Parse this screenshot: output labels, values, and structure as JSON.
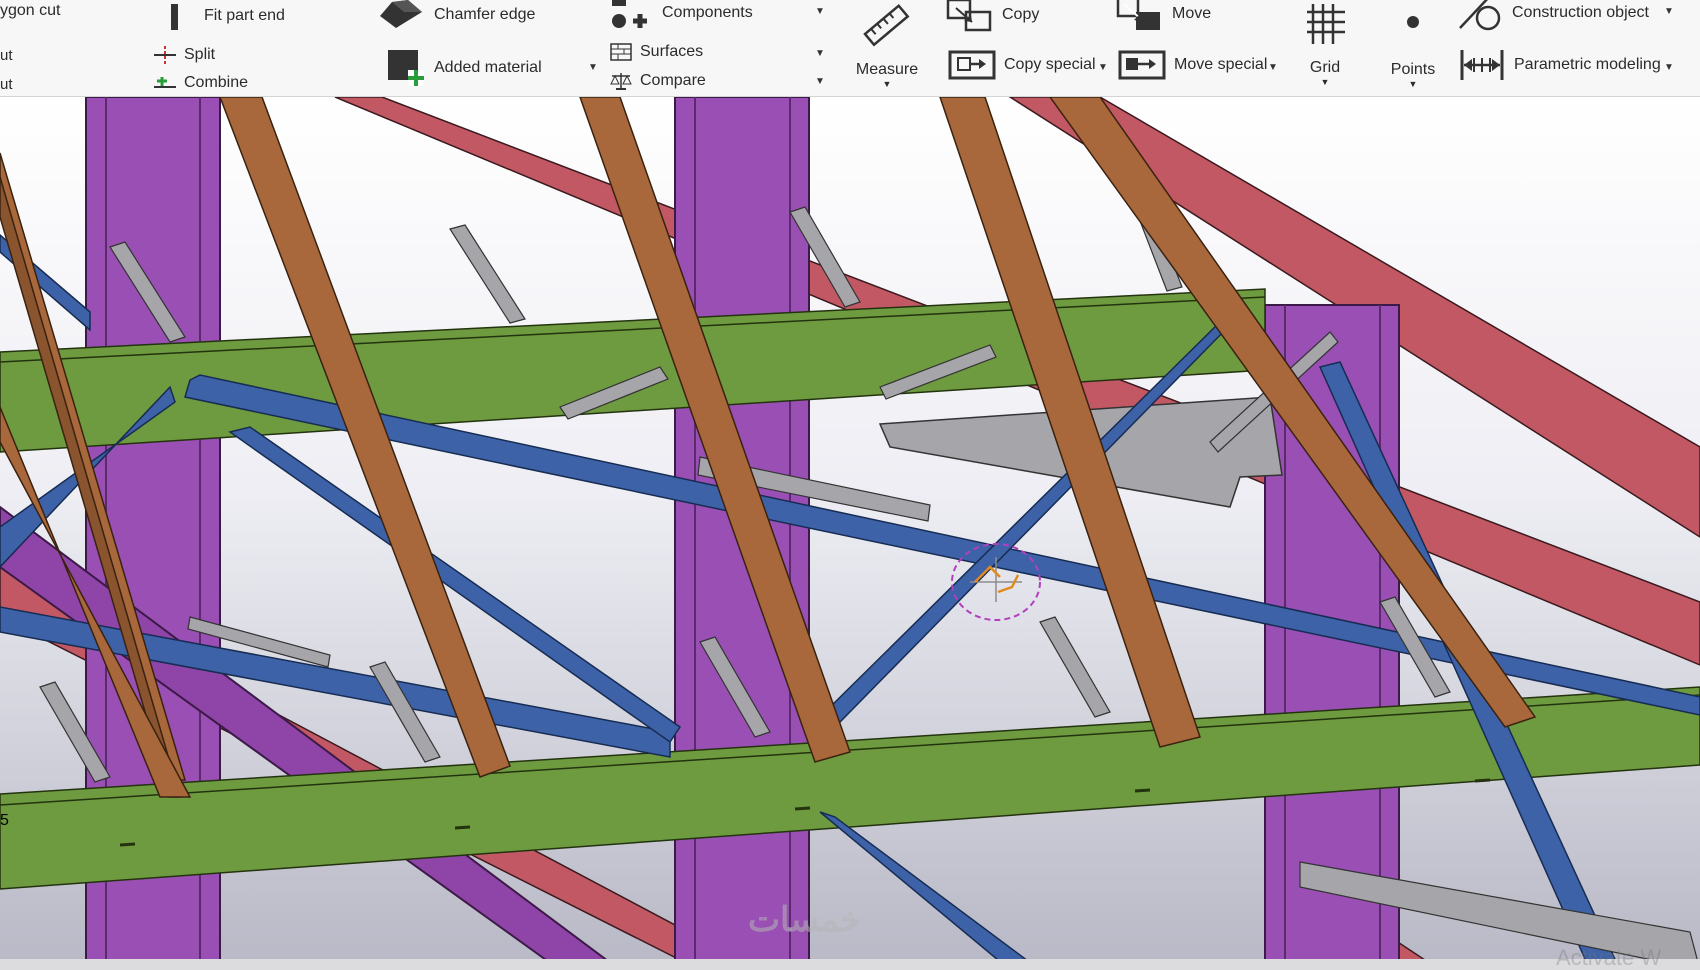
{
  "ribbon": {
    "polygon_cut": "ygon cut",
    "cut_a": "ut",
    "cut_b": "ut",
    "fit_part_end": "Fit part end",
    "split": "Split",
    "combine": "Combine",
    "chamfer_edge": "Chamfer edge",
    "added_material": "Added material",
    "components": "Components",
    "surfaces": "Surfaces",
    "compare": "Compare",
    "measure": "Measure",
    "copy": "Copy",
    "copy_special": "Copy special",
    "move": "Move",
    "move_special": "Move special",
    "grid": "Grid",
    "points": "Points",
    "construction_object": "Construction object",
    "parametric_modeling": "Parametric modeling"
  },
  "viewport": {
    "edge_label": "5",
    "watermark": "خمسات",
    "activate_text": "Activate W"
  },
  "colors": {
    "column": "#9a4fb4",
    "rafter": "#a8683c",
    "purlin": "#6e9a40",
    "brace": "#3d62a8",
    "top_chord": "#c25864",
    "gusset": "#a5a5aa",
    "selection": "#b23fbf",
    "gizmo": "#e08a20"
  }
}
